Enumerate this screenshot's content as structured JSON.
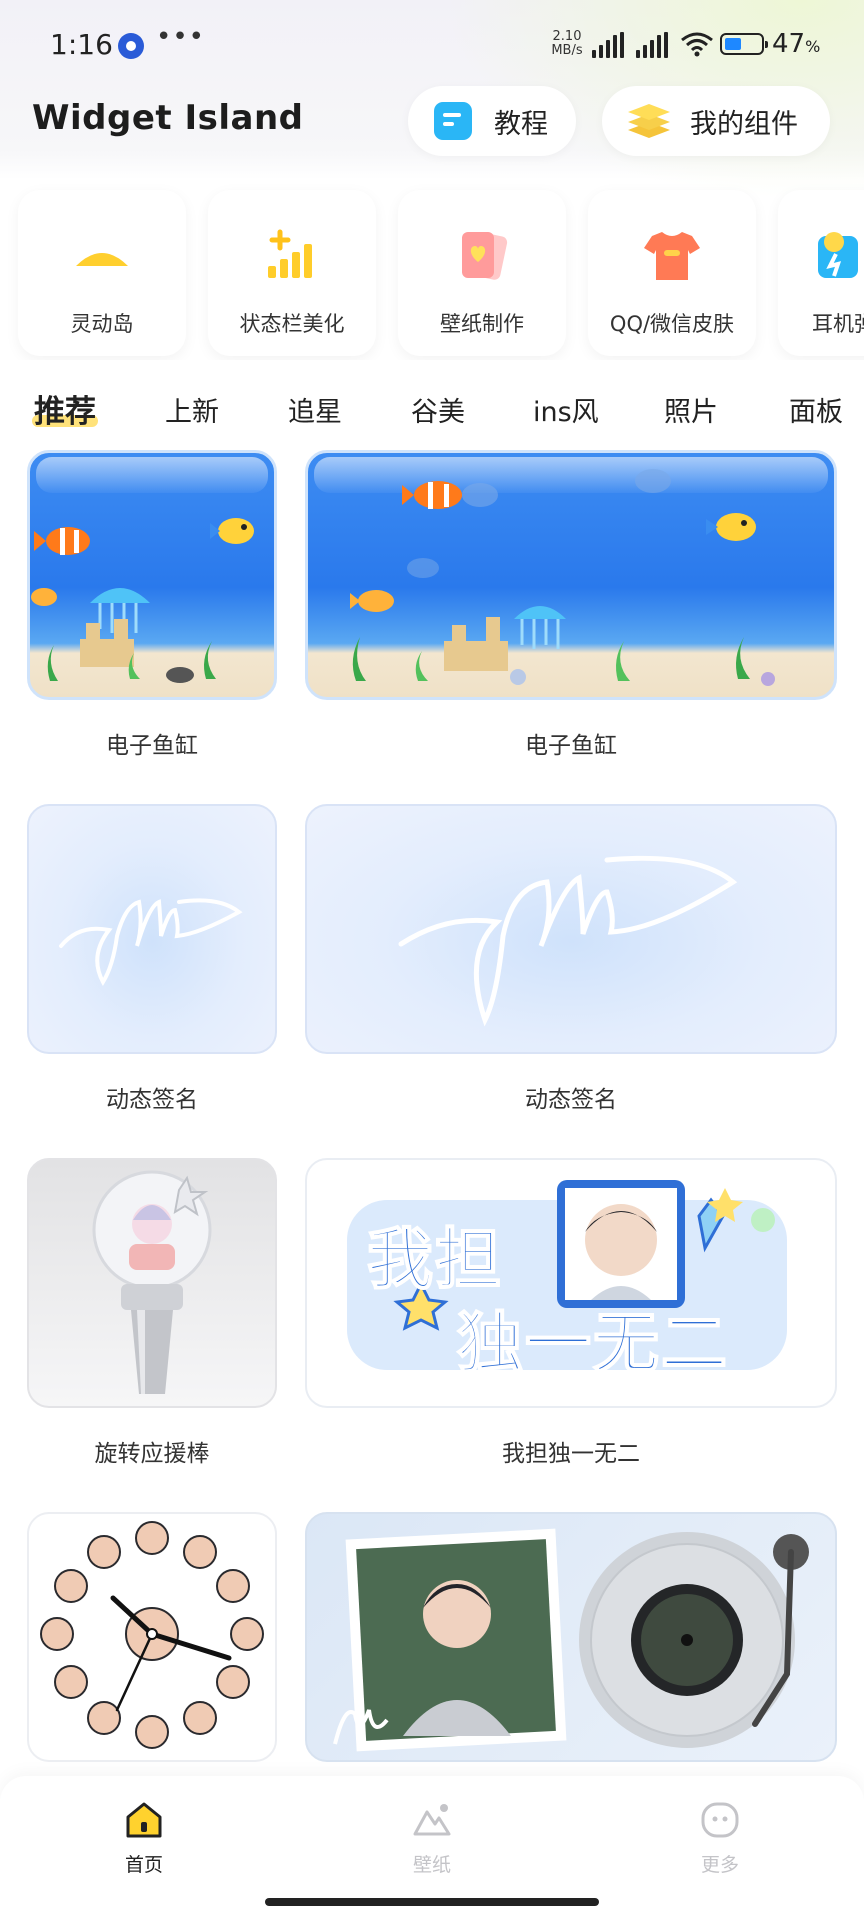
{
  "status_bar": {
    "time": "1:16",
    "speed_value": "2.10",
    "speed_unit": "MB/s",
    "battery_percent": "47",
    "battery_unit": "%",
    "battery_level": 0.47
  },
  "header": {
    "app_title": "Widget Island",
    "tutorial_label": "教程",
    "my_widgets_label": "我的组件"
  },
  "categories": [
    {
      "label": "灵动岛",
      "icon": "island-pill-icon"
    },
    {
      "label": "状态栏美化",
      "icon": "signal-bars-icon"
    },
    {
      "label": "壁纸制作",
      "icon": "wallpaper-card-icon"
    },
    {
      "label": "QQ/微信皮肤",
      "icon": "tshirt-icon"
    },
    {
      "label": "耳机弹",
      "icon": "headphone-icon"
    }
  ],
  "tabs": [
    "推荐",
    "上新",
    "追星",
    "谷美",
    "ins风",
    "照片",
    "面板"
  ],
  "widgets": [
    {
      "caption": "电子鱼缸"
    },
    {
      "caption": "电子鱼缸"
    },
    {
      "caption": "动态签名"
    },
    {
      "caption": "动态签名"
    },
    {
      "caption": "旋转应援棒"
    },
    {
      "caption": "我担独一无二"
    }
  ],
  "banner_text": {
    "line1": "我担",
    "line2": "独一无二"
  },
  "bottom_nav": {
    "home": "首页",
    "wallpaper": "壁纸",
    "more": "更多"
  },
  "colors": {
    "accent_yellow": "#ffd22e",
    "tank_blue": "#2a79ec",
    "active_nav": "#222222",
    "inactive_nav": "#c4c4c8"
  }
}
